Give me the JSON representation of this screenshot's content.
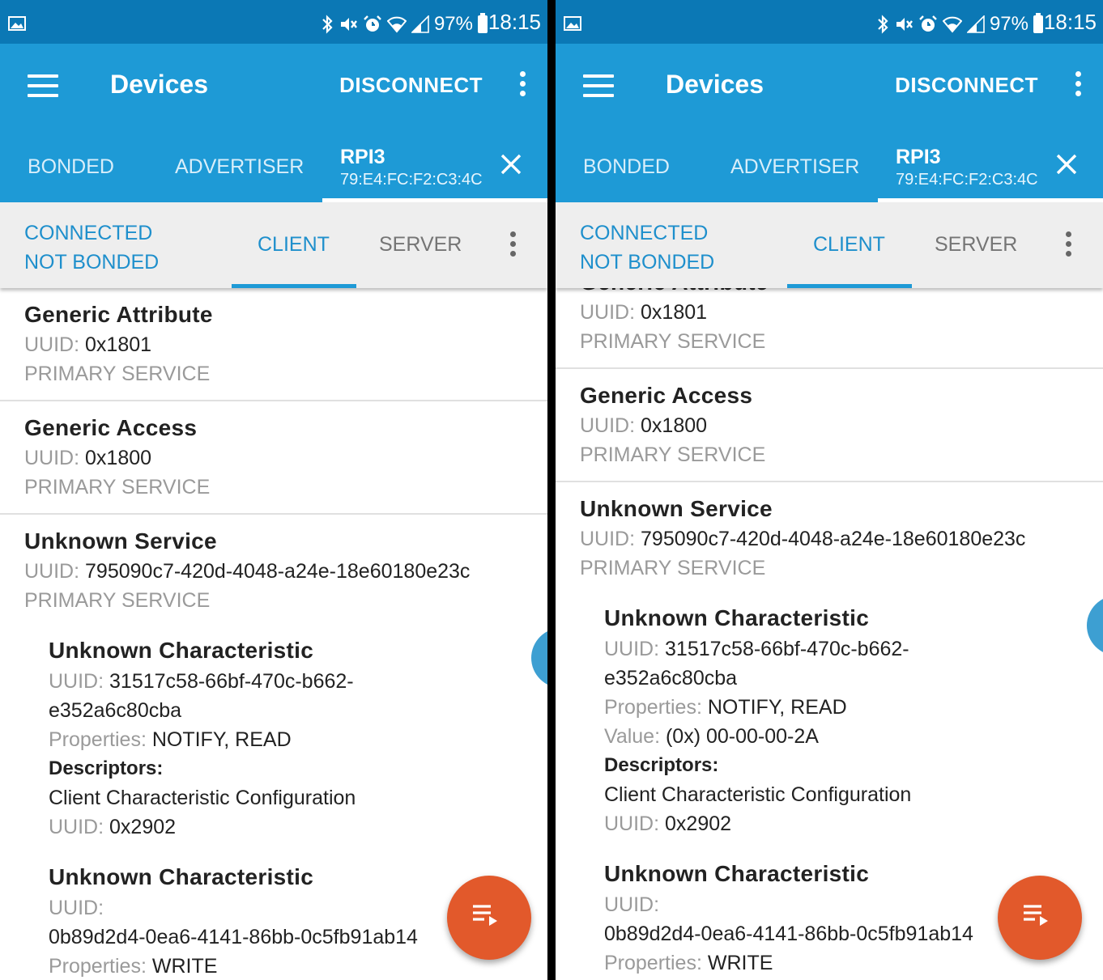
{
  "status_bar": {
    "battery": "97%",
    "time": "18:15"
  },
  "app_bar": {
    "title": "Devices",
    "disconnect_label": "DISCONNECT"
  },
  "tabs": {
    "bonded": "BONDED",
    "advertiser": "ADVERTISER",
    "device_name": "RPI3",
    "device_address": "79:E4:FC:F2:C3:4C"
  },
  "connection": {
    "state": "CONNECTED",
    "bond_state": "NOT BONDED",
    "client_tab": "CLIENT",
    "server_tab": "SERVER"
  },
  "labels": {
    "uuid": "UUID:",
    "properties": "Properties:",
    "value": "Value:",
    "descriptors": "Descriptors:",
    "primary_service": "PRIMARY SERVICE"
  },
  "services": [
    {
      "name": "Generic Attribute",
      "uuid": "0x1801"
    },
    {
      "name": "Generic Access",
      "uuid": "0x1800"
    },
    {
      "name": "Unknown Service",
      "uuid": "795090c7-420d-4048-a24e-18e60180e23c"
    }
  ],
  "characteristics": [
    {
      "name": "Unknown Characteristic",
      "uuid_line1": "31517c58-66bf-470c-b662-",
      "uuid_line2": "e352a6c80cba",
      "properties": "NOTIFY, READ",
      "value": "(0x) 00-00-00-2A",
      "descriptor": {
        "name": "Client Characteristic Configuration",
        "uuid": "0x2902"
      }
    },
    {
      "name": "Unknown Characteristic",
      "uuid": "0b89d2d4-0ea6-4141-86bb-0c5fb91ab14",
      "properties": "WRITE"
    }
  ],
  "colors": {
    "status_bar": "#0b78b5",
    "app_bar": "#1e9ad6",
    "accent": "#1e8fcc",
    "fab": "#e2592b",
    "read_button": "#3d9fd2"
  },
  "icons": {
    "menu": "menu-icon",
    "overflow": "more-vert-icon",
    "close": "close-icon",
    "read": "download-icon",
    "notify": "notify-arrows-icon",
    "write": "upload-icon",
    "fab": "log-list-icon"
  }
}
